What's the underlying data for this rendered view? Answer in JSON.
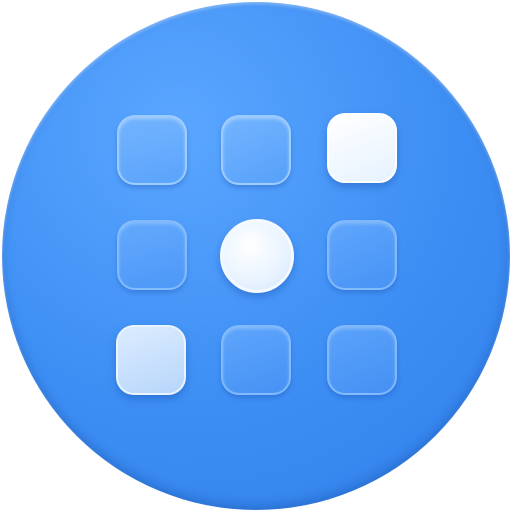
{
  "icon": {
    "name": "app-launcher-grid-icon",
    "colors": {
      "background": "#3d8ef4",
      "tile_dim": "#8cc3ff",
      "tile_bright": "#ffffff",
      "tile_light": "#cfe3fb"
    },
    "tiles": [
      {
        "row": 1,
        "col": 1,
        "shape": "rounded-square",
        "state": "dim"
      },
      {
        "row": 1,
        "col": 2,
        "shape": "rounded-square",
        "state": "dim"
      },
      {
        "row": 1,
        "col": 3,
        "shape": "rounded-square",
        "state": "bright"
      },
      {
        "row": 2,
        "col": 1,
        "shape": "rounded-square",
        "state": "faint"
      },
      {
        "row": 2,
        "col": 2,
        "shape": "circle",
        "state": "bright"
      },
      {
        "row": 2,
        "col": 3,
        "shape": "rounded-square",
        "state": "faint"
      },
      {
        "row": 3,
        "col": 1,
        "shape": "rounded-square",
        "state": "light"
      },
      {
        "row": 3,
        "col": 2,
        "shape": "rounded-square",
        "state": "faint"
      },
      {
        "row": 3,
        "col": 3,
        "shape": "rounded-square",
        "state": "faint"
      }
    ]
  }
}
